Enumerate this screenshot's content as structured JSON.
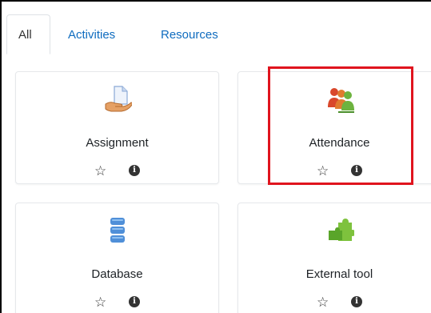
{
  "tabs": [
    {
      "label": "All",
      "active": true
    },
    {
      "label": "Activities",
      "active": false
    },
    {
      "label": "Resources",
      "active": false
    }
  ],
  "modules": [
    {
      "name": "Assignment",
      "icon": "assignment-icon"
    },
    {
      "name": "Attendance",
      "icon": "attendance-icon"
    },
    {
      "name": "Database",
      "icon": "database-icon"
    },
    {
      "name": "External tool",
      "icon": "external-tool-icon"
    }
  ],
  "icons": {
    "star": "☆",
    "info": "i"
  },
  "colors": {
    "link": "#0f6cbf",
    "highlight": "#e0141e",
    "database": "#4f8fd8",
    "external_tool": "#7ec23d",
    "attendance_red": "#d9472b",
    "attendance_green": "#6db33f"
  }
}
